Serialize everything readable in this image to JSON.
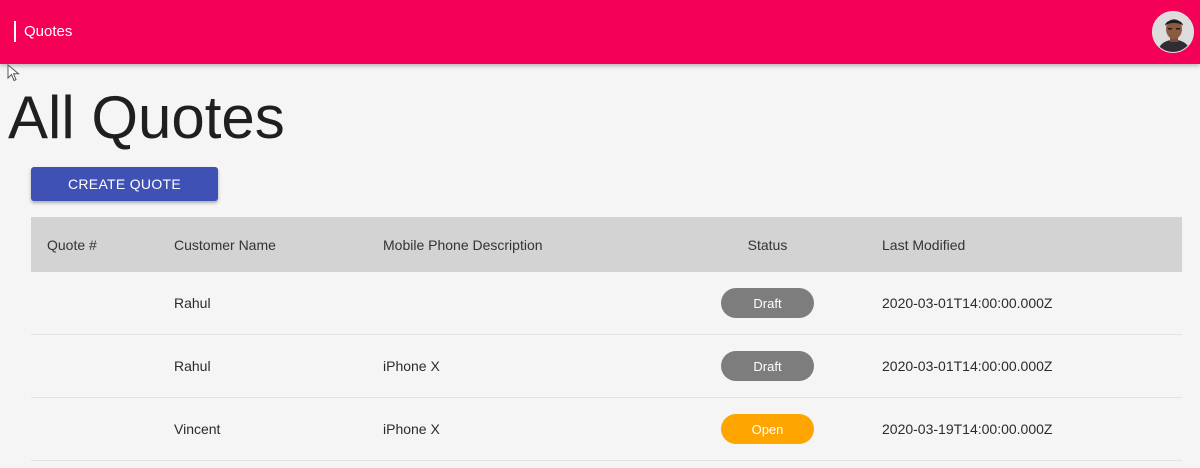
{
  "header": {
    "title": "Quotes",
    "bar_color": "#f50057",
    "avatar_icon": "user-avatar"
  },
  "page": {
    "title": "All Quotes"
  },
  "actions": {
    "create_label": "CREATE QUOTE",
    "create_color": "#3f51b5"
  },
  "table": {
    "columns": {
      "quote": "Quote #",
      "customer": "Customer Name",
      "description": "Mobile Phone Description",
      "status": "Status",
      "modified": "Last Modified"
    },
    "rows": [
      {
        "quote": "",
        "customer": "Rahul",
        "description": "",
        "status": "Draft",
        "status_color": "#7d7d7d",
        "modified": "2020-03-01T14:00:00.000Z"
      },
      {
        "quote": "",
        "customer": "Rahul",
        "description": "iPhone X",
        "status": "Draft",
        "status_color": "#7d7d7d",
        "modified": "2020-03-01T14:00:00.000Z"
      },
      {
        "quote": "",
        "customer": "Vincent",
        "description": "iPhone X",
        "status": "Open",
        "status_color": "#ffa500",
        "modified": "2020-03-19T14:00:00.000Z"
      }
    ]
  }
}
